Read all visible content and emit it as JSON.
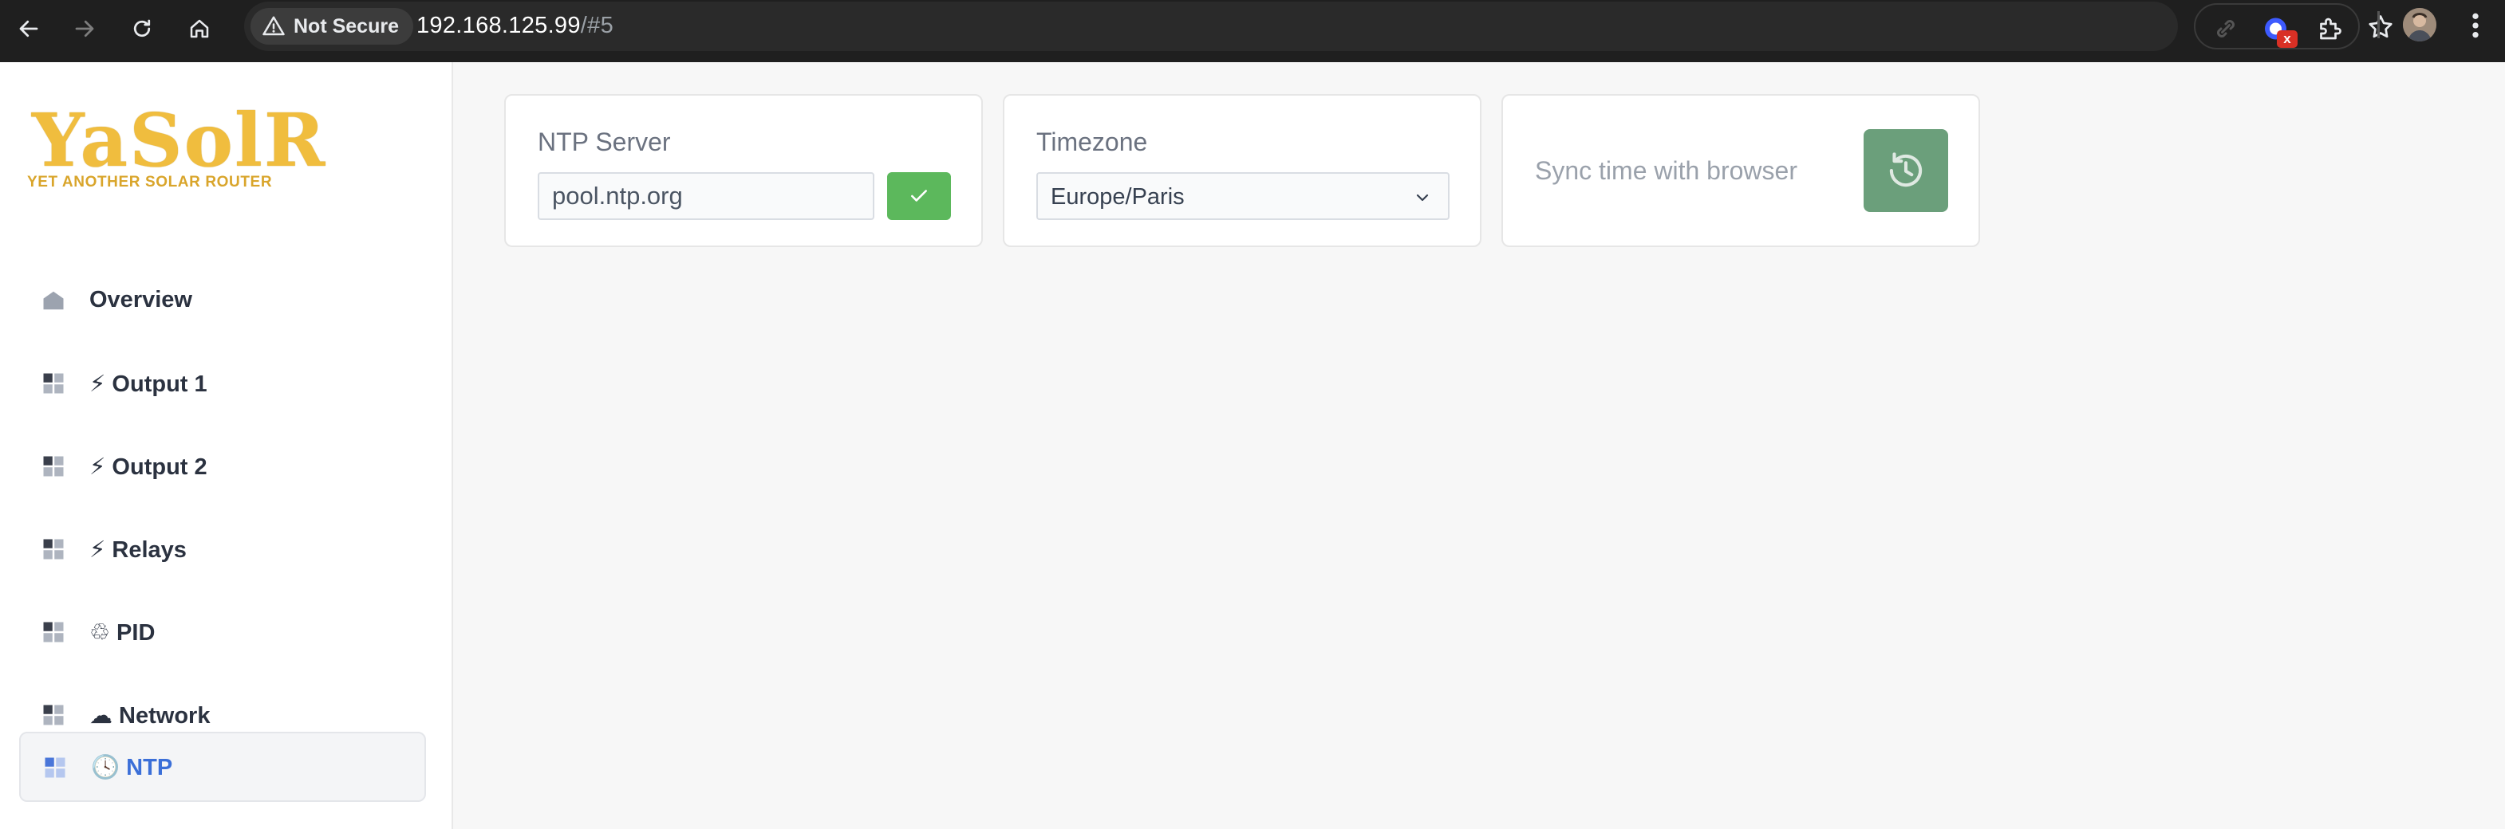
{
  "browser": {
    "security_label": "Not Secure",
    "url_host": "192.168.125.99",
    "url_path": "/#5",
    "extension_badge": "x"
  },
  "app": {
    "logo_title": "YaSolR",
    "logo_subtitle": "YET ANOTHER SOLAR ROUTER",
    "brand_color": "#f0bd3e"
  },
  "sidebar": {
    "items": [
      {
        "label": "Overview",
        "icon": "home-icon",
        "active": false
      },
      {
        "label": "⚡ Output 1",
        "icon": "dashboard-icon",
        "active": false
      },
      {
        "label": "⚡ Output 2",
        "icon": "dashboard-icon",
        "active": false
      },
      {
        "label": "⚡ Relays",
        "icon": "dashboard-icon",
        "active": false
      },
      {
        "label": "♲ PID",
        "icon": "dashboard-icon",
        "active": false
      },
      {
        "label": "☁ Network",
        "icon": "dashboard-icon",
        "active": false
      },
      {
        "label": "🕓 NTP",
        "icon": "dashboard-icon",
        "active": true
      }
    ]
  },
  "ntp_server": {
    "title": "NTP Server",
    "value": "pool.ntp.org",
    "confirm_icon": "check-icon",
    "button_color": "#5cb85c"
  },
  "timezone": {
    "title": "Timezone",
    "selected": "Europe/Paris"
  },
  "sync": {
    "label": "Sync time with browser",
    "button_icon": "history-icon",
    "button_color": "#6b9f7b"
  }
}
